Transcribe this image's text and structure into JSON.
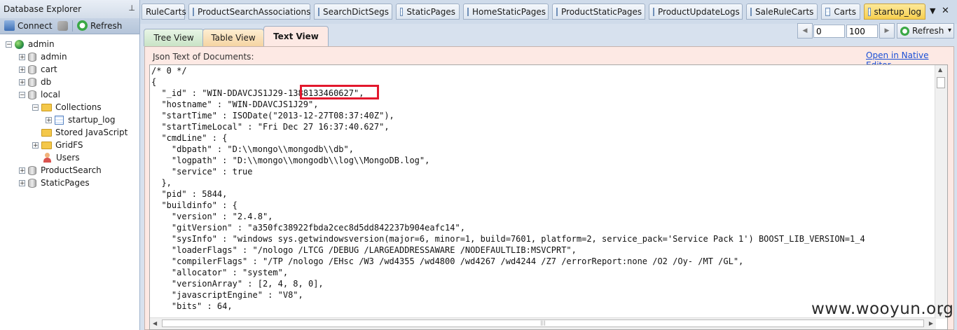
{
  "explorer": {
    "title": "Database Explorer",
    "pin_glyph": "⊥",
    "toolbar": {
      "connect_label": "Connect",
      "refresh_label": "Refresh"
    },
    "tree": [
      {
        "label": "admin",
        "kind": "server",
        "expander": "−"
      },
      {
        "label": "admin",
        "kind": "db",
        "expander": "+"
      },
      {
        "label": "cart",
        "kind": "db",
        "expander": "+"
      },
      {
        "label": "db",
        "kind": "db",
        "expander": "+"
      },
      {
        "label": "local",
        "kind": "db",
        "expander": "−"
      },
      {
        "label": "Collections",
        "kind": "folder",
        "expander": "−"
      },
      {
        "label": "startup_log",
        "kind": "collection",
        "expander": "+"
      },
      {
        "label": "Stored JavaScript",
        "kind": "folder",
        "expander": ""
      },
      {
        "label": "GridFS",
        "kind": "folder",
        "expander": "+"
      },
      {
        "label": "Users",
        "kind": "user",
        "expander": ""
      },
      {
        "label": "ProductSearch",
        "kind": "db",
        "expander": "+"
      },
      {
        "label": "StaticPages",
        "kind": "db",
        "expander": "+"
      }
    ]
  },
  "doc_tabs": [
    {
      "label": "RuleCarts",
      "active": false
    },
    {
      "label": "ProductSearchAssociations",
      "active": false
    },
    {
      "label": "SearchDictSegs",
      "active": false
    },
    {
      "label": "StaticPages",
      "active": false
    },
    {
      "label": "HomeStaticPages",
      "active": false
    },
    {
      "label": "ProductStaticPages",
      "active": false
    },
    {
      "label": "ProductUpdateLogs",
      "active": false
    },
    {
      "label": "SaleRuleCarts",
      "active": false
    },
    {
      "label": "Carts",
      "active": false
    },
    {
      "label": "startup_log",
      "active": true
    }
  ],
  "tab_overflow_glyph": "▼",
  "close_glyph": "✕",
  "view_tabs": [
    {
      "label": "Tree View"
    },
    {
      "label": "Table View"
    },
    {
      "label": "Text View",
      "active": true
    }
  ],
  "pager": {
    "skip": "0",
    "limit": "100",
    "refresh_label": "Refresh",
    "prev_glyph": "◀",
    "next_glyph": "▶",
    "dropdown_glyph": "▾"
  },
  "content": {
    "header_label": "Json Text of Documents:",
    "native_editor_link": "Open in Native Editor",
    "json_lines": [
      "/* 0 */",
      "{",
      "  \"_id\" : \"WIN-DDAVCJS1J29-1388133460627\",",
      "  \"hostname\" : \"WIN-DDAVCJS1J29\",",
      "  \"startTime\" : ISODate(\"2013-12-27T08:37:40Z\"),",
      "  \"startTimeLocal\" : \"Fri Dec 27 16:37:40.627\",",
      "  \"cmdLine\" : {",
      "    \"dbpath\" : \"D:\\\\mongo\\\\mongodb\\\\db\",",
      "    \"logpath\" : \"D:\\\\mongo\\\\mongodb\\\\log\\\\MongoDB.log\",",
      "    \"service\" : true",
      "  },",
      "  \"pid\" : 5844,",
      "  \"buildinfo\" : {",
      "    \"version\" : \"2.4.8\",",
      "    \"gitVersion\" : \"a350fc38922fbda2cec8d5dd842237b904eafc14\",",
      "    \"sysInfo\" : \"windows sys.getwindowsversion(major=6, minor=1, build=7601, platform=2, service_pack='Service Pack 1') BOOST_LIB_VERSION=1_4",
      "    \"loaderFlags\" : \"/nologo /LTCG /DEBUG /LARGEADDRESSAWARE /NODEFAULTLIB:MSVCPRT\",",
      "    \"compilerFlags\" : \"/TP /nologo /EHsc /W3 /wd4355 /wd4800 /wd4267 /wd4244 /Z7 /errorReport:none /O2 /Oy- /MT /GL\",",
      "    \"allocator\" : \"system\",",
      "    \"versionArray\" : [2, 4, 8, 0],",
      "    \"javascriptEngine\" : \"V8\",",
      "    \"bits\" : 64,"
    ],
    "scroll_up_glyph": "▲",
    "scroll_down_glyph": "▼",
    "scroll_left_glyph": "◀",
    "scroll_right_glyph": "▶",
    "grip_glyph": "|||"
  },
  "watermark": "www.wooyun.org",
  "colors": {
    "highlight": "#e3182d",
    "active_tab": "#f7cf4f",
    "content_bg": "#fde9e4",
    "link": "#1a4fd6"
  }
}
